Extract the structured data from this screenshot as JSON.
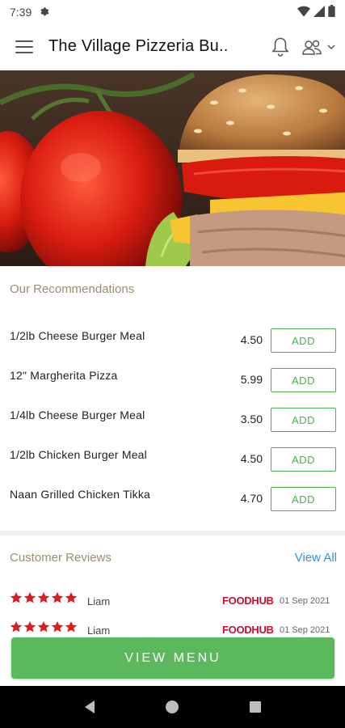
{
  "status_bar": {
    "time": "7:39"
  },
  "app_bar": {
    "title": "The Village Pizzeria Bu.."
  },
  "recommendations": {
    "title": "Our Recommendations",
    "items": [
      {
        "name": "1/2lb Cheese Burger Meal",
        "price": "4.50",
        "button": "ADD"
      },
      {
        "name": "12\" Margherita Pizza",
        "price": "5.99",
        "button": "ADD"
      },
      {
        "name": "1/4lb Cheese Burger Meal",
        "price": "3.50",
        "button": "ADD"
      },
      {
        "name": "1/2lb Chicken Burger Meal",
        "price": "4.50",
        "button": "ADD"
      },
      {
        "name": "Naan Grilled Chicken Tikka",
        "price": "4.70",
        "button": "ADD"
      }
    ]
  },
  "reviews": {
    "title": "Customer Reviews",
    "view_all": "View All",
    "items": [
      {
        "reviewer": "Liam",
        "rating": 5,
        "source": "FOODHUB",
        "date": "01 Sep 2021"
      },
      {
        "reviewer": "Liam",
        "rating": 5,
        "source": "FOODHUB",
        "date": "01 Sep 2021"
      }
    ]
  },
  "view_menu": {
    "label": "VIEW MENU"
  },
  "colors": {
    "accent_green": "#5cb85c",
    "section_title": "#9b8e6e",
    "link_blue": "#3a8fd6",
    "star_red": "#d81e1e",
    "foodhub_red": "#c8102e"
  },
  "icons": {
    "status": [
      "settings-icon",
      "wifi-icon",
      "signal-icon",
      "battery-icon"
    ],
    "app_bar": [
      "hamburger-menu-icon",
      "bell-icon",
      "account-icon",
      "chevron-down-icon"
    ],
    "nav": [
      "back-icon",
      "home-icon",
      "recents-icon"
    ]
  }
}
